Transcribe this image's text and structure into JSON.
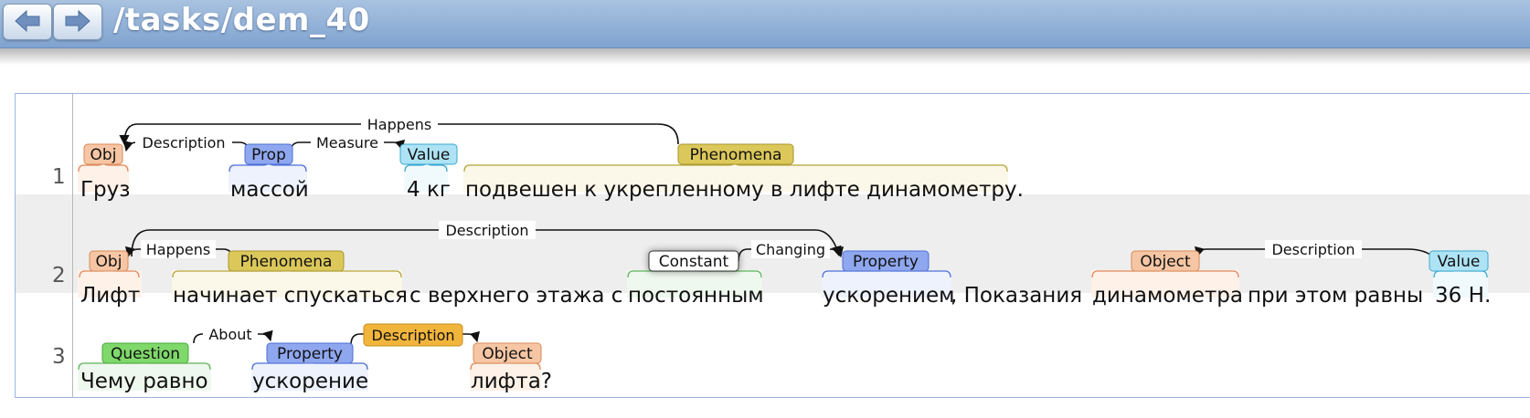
{
  "header": {
    "back_icon": "arrow-left-icon",
    "forward_icon": "arrow-right-icon",
    "title": "/tasks/dem_40"
  },
  "sentences": [
    {
      "number": "1",
      "tokens": [
        {
          "text": "Груз"
        },
        {
          "text": "массой"
        },
        {
          "text": "4 кг"
        },
        {
          "text": "подвешен к укрепленному в лифте динамометру."
        }
      ],
      "spans": [
        {
          "label": "Obj",
          "type": "object"
        },
        {
          "label": "Prop",
          "type": "property"
        },
        {
          "label": "Value",
          "type": "value"
        },
        {
          "label": "Phenomena",
          "type": "phenomena"
        }
      ],
      "arcs": [
        {
          "label": "Happens"
        },
        {
          "label": "Description"
        },
        {
          "label": "Measure"
        }
      ]
    },
    {
      "number": "2",
      "tokens": [
        {
          "text": "Лифт"
        },
        {
          "text": "начинает спускаться"
        },
        {
          "text": "с верхнего этажа с"
        },
        {
          "text": "постоянным"
        },
        {
          "text": "ускорением"
        },
        {
          "text": ", Показания"
        },
        {
          "text": "динамометра"
        },
        {
          "text": "при этом равны"
        },
        {
          "text": "36 Н"
        },
        {
          "text": "."
        }
      ],
      "spans": [
        {
          "label": "Obj",
          "type": "object"
        },
        {
          "label": "Phenomena",
          "type": "phenomena"
        },
        {
          "label": "Constant",
          "type": "constant"
        },
        {
          "label": "Property",
          "type": "property"
        },
        {
          "label": "Object",
          "type": "object"
        },
        {
          "label": "Value",
          "type": "value"
        }
      ],
      "arcs": [
        {
          "label": "Description"
        },
        {
          "label": "Happens"
        },
        {
          "label": "Changing"
        },
        {
          "label": "Description"
        }
      ]
    },
    {
      "number": "3",
      "tokens": [
        {
          "text": "Чему равно"
        },
        {
          "text": "ускорение"
        },
        {
          "text": "лифта?"
        }
      ],
      "spans": [
        {
          "label": "Question",
          "type": "question"
        },
        {
          "label": "Property",
          "type": "property"
        },
        {
          "label": "Object",
          "type": "object"
        }
      ],
      "arcs": [
        {
          "label": "About"
        },
        {
          "label": "Description"
        }
      ]
    }
  ],
  "colors": {
    "object": "#f6c6a4",
    "property": "#8fa7ef",
    "value": "#aee3f5",
    "phenomena": "#dcc85a",
    "constant": "#ffffff",
    "question": "#7fd86a",
    "description_highlight": "#f2b53c",
    "row_alt_bg": "#eeeeee",
    "header_bg": "#8aa9d3"
  }
}
